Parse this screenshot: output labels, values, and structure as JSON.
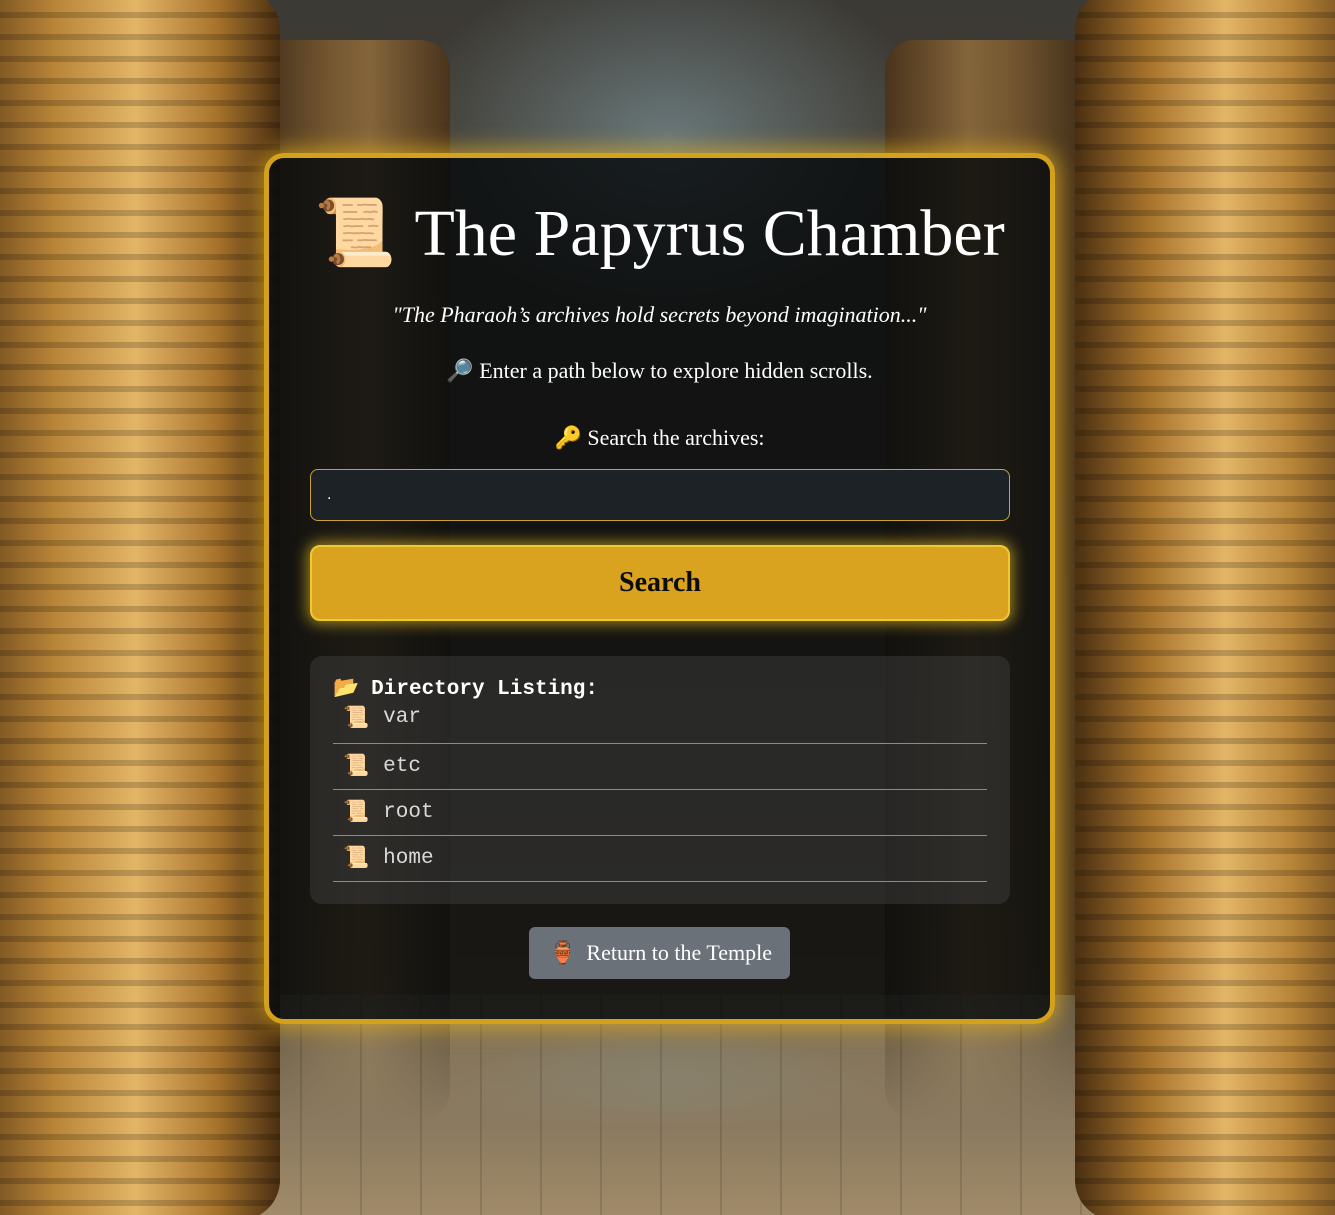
{
  "header": {
    "title": "The Papyrus Chamber",
    "title_icon": "scroll-icon",
    "quote": "\"The Pharaoh’s archives hold secrets beyond imagination...\"",
    "hint_icon": "magnifier-icon",
    "hint": "Enter a path below to explore hidden scrolls."
  },
  "search": {
    "label_icon": "key-icon",
    "label": "Search the archives:",
    "value": ".",
    "button_label": "Search"
  },
  "listing": {
    "heading_icon": "open-folder-icon",
    "heading": "Directory Listing:",
    "items": [
      {
        "icon": "scroll-icon",
        "name": "var"
      },
      {
        "icon": "scroll-icon",
        "name": "etc"
      },
      {
        "icon": "scroll-icon",
        "name": "root"
      },
      {
        "icon": "scroll-icon",
        "name": "home"
      }
    ]
  },
  "footer": {
    "return_icon": "amphora-icon",
    "return_label": "Return to the Temple"
  },
  "colors": {
    "accent": "#d9a31f",
    "border": "#d4a21a",
    "card_bg": "#060a0c"
  }
}
